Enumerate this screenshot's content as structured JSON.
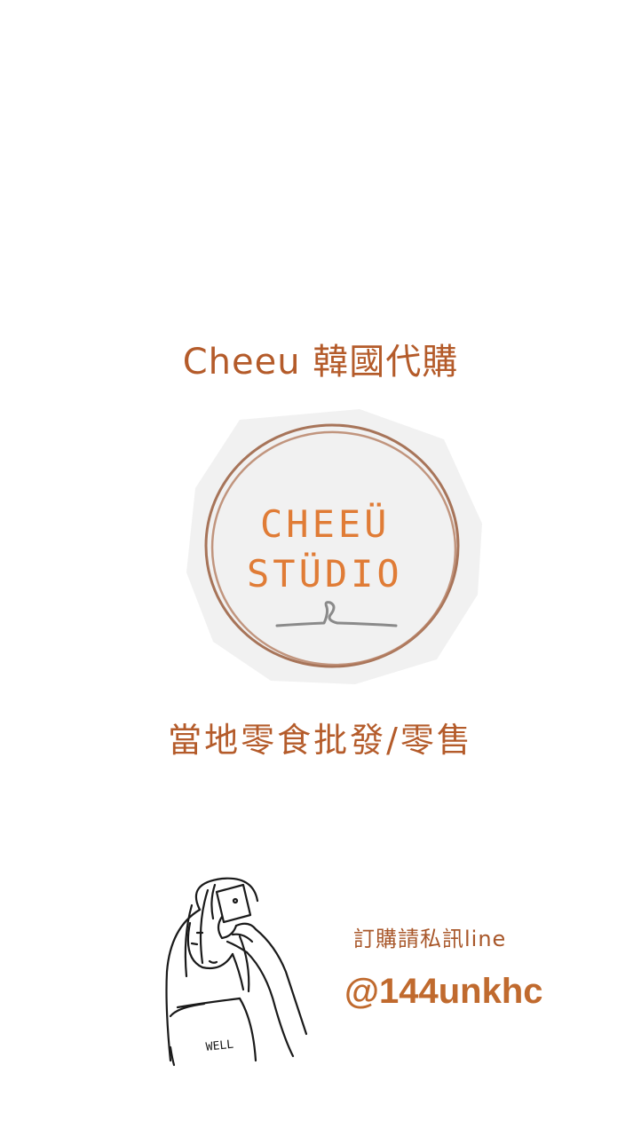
{
  "header": {
    "title": "Cheeu 韓國代購"
  },
  "logo": {
    "name": "studio-logo",
    "line1": "CHEEÜ",
    "line2": "STÜDIO"
  },
  "tagline": "當地零食批發/零售",
  "contact": {
    "note": "訂購請私訊line",
    "line_id": "@144unkhc"
  },
  "illustration": {
    "icon": "girl-selfie-illustration-icon",
    "shirt_text": "WELL"
  },
  "colors": {
    "accent": "#b45b2a",
    "logo_text": "#e07c36",
    "ring": "#9a5e3e",
    "ribbon": "#8a8a8a",
    "paper": "#f2f2f2"
  }
}
